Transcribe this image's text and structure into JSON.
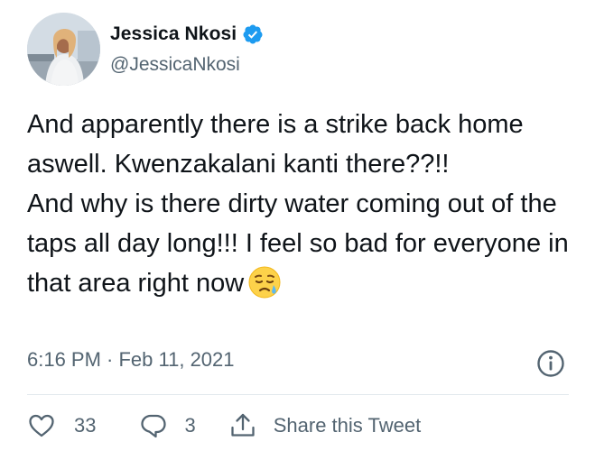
{
  "author": {
    "display_name": "Jessica Nkosi",
    "handle": "@JessicaNkosi",
    "verified": true
  },
  "tweet": {
    "lines": [
      "And apparently there is a strike back home aswell. Kwenzakalani kanti there??!!",
      "And why is there dirty water coming out of the taps all day long!!! I feel so bad for everyone in that area right now"
    ],
    "trailing_emoji": "sad-relieved-face-emoji"
  },
  "meta": {
    "timestamp": "6:16 PM · Feb 11, 2021"
  },
  "actions": {
    "likes": "33",
    "replies": "3",
    "share_label": "Share this Tweet"
  },
  "colors": {
    "text": "#0f1419",
    "secondary": "#536471",
    "verified_blue": "#1d9bf0",
    "divider": "#e1e8ed"
  }
}
